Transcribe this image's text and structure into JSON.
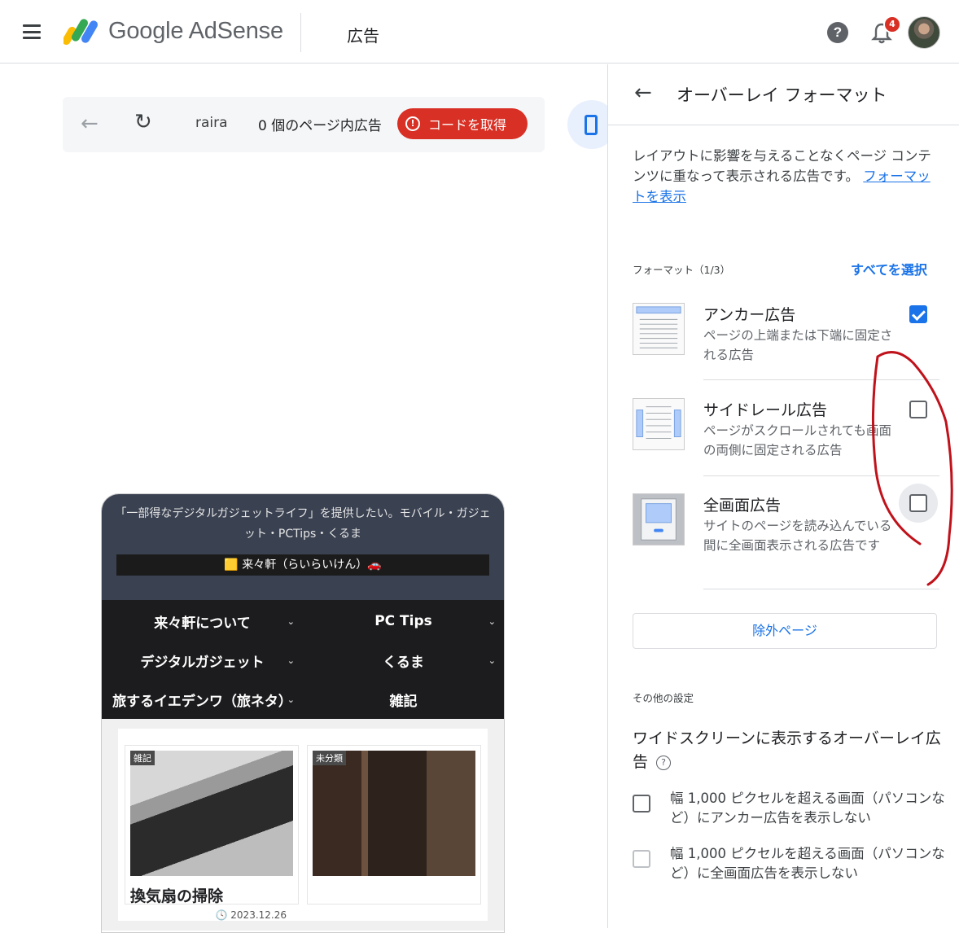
{
  "header": {
    "brand": "Google AdSense",
    "page_title": "広告",
    "notification_count": "4",
    "help_glyph": "?"
  },
  "toolbar": {
    "back_glyph": "←",
    "reload_glyph": "↻",
    "site_name": "raira",
    "ad_count": "0 個のページ内広告",
    "get_code_label": "コードを取得",
    "get_code_glyph": "!"
  },
  "preview": {
    "tagline": "「一部得なデジタルガジェットライフ」を提供したい。モバイル・ガジェット・PCTips・くるま",
    "logo_text": "🟨 来々軒（らいらいけん）🚗",
    "nav": [
      {
        "label": "来々軒について",
        "chevron": "⌄"
      },
      {
        "label": "PC Tips",
        "chevron": "⌄"
      },
      {
        "label": "デジタルガジェット",
        "chevron": "⌄"
      },
      {
        "label": "くるま",
        "chevron": "⌄"
      },
      {
        "label": "旅するイエデンワ（旅ネタ）",
        "chevron": "⌄"
      },
      {
        "label": "雑記",
        "chevron": ""
      }
    ],
    "cards": [
      {
        "tag": "雑記",
        "title": "換気扇の掃除",
        "date": "🕓 2023.12.26"
      },
      {
        "tag": "未分類",
        "title": "",
        "date": ""
      }
    ]
  },
  "panel": {
    "back_glyph": "←",
    "title": "オーバーレイ フォーマット",
    "description": "レイアウトに影響を与えることなくページ コンテンツに重なって表示される広告です。",
    "description_link": "フォーマットを表示",
    "formats_label": "フォーマット（1/3）",
    "select_all": "すべてを選択",
    "formats": [
      {
        "name": "アンカー広告",
        "desc": "ページの上端または下端に固定される広告",
        "checked": true
      },
      {
        "name": "サイドレール広告",
        "desc": "ページがスクロールされても画面の両側に固定される広告",
        "checked": false
      },
      {
        "name": "全画面広告",
        "desc": "サイトのページを読み込んでいる間に全画面表示される広告です",
        "checked": false
      }
    ],
    "exclude_pages": "除外ページ",
    "other_settings_label": "その他の設定",
    "widescreen_title": "ワイドスクリーンに表示するオーバーレイ広告",
    "help_glyph": "?",
    "options": [
      {
        "text": "幅 1,000 ピクセルを超える画面（パソコンなど）にアンカー広告を表示しない",
        "enabled": true
      },
      {
        "text": "幅 1,000 ピクセルを超える画面（パソコンなど）に全画面広告を表示しない",
        "enabled": false
      }
    ]
  },
  "colors": {
    "accent": "#1a73e8",
    "danger": "#d93025",
    "annotation": "#c0121b"
  }
}
